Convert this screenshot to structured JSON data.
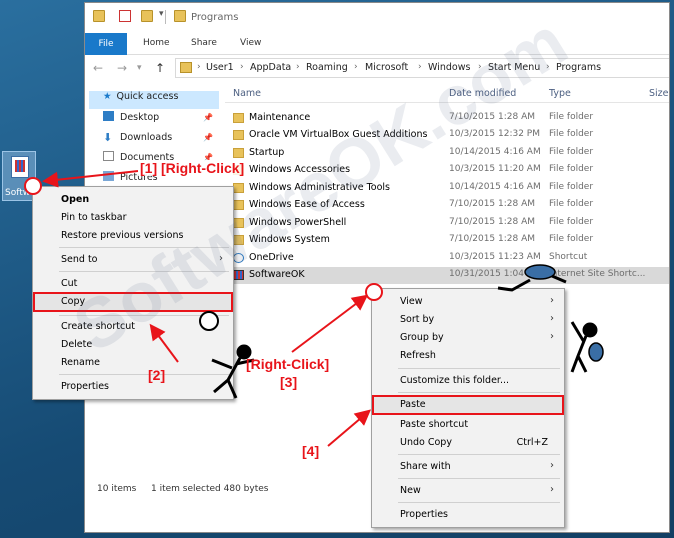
{
  "window": {
    "title": "Programs",
    "ribbon_tabs": [
      "File",
      "Home",
      "Share",
      "View"
    ],
    "breadcrumb": [
      "User1",
      "AppData",
      "Roaming",
      "Microsoft",
      "Windows",
      "Start Menu",
      "Programs"
    ]
  },
  "nav": {
    "items": [
      "Quick access",
      "Desktop",
      "Downloads",
      "Documents",
      "Pictures"
    ]
  },
  "columns": {
    "name": "Name",
    "date": "Date modified",
    "type": "Type",
    "size": "Size"
  },
  "files": [
    {
      "name": "Maintenance",
      "date": "7/10/2015 1:28 AM",
      "type": "File folder"
    },
    {
      "name": "Oracle VM VirtualBox Guest Additions",
      "date": "10/3/2015 12:32 PM",
      "type": "File folder"
    },
    {
      "name": "Startup",
      "date": "10/14/2015 4:16 AM",
      "type": "File folder"
    },
    {
      "name": "Windows Accessories",
      "date": "10/3/2015 11:20 AM",
      "type": "File folder"
    },
    {
      "name": "Windows Administrative Tools",
      "date": "10/14/2015 4:16 AM",
      "type": "File folder"
    },
    {
      "name": "Windows Ease of Access",
      "date": "7/10/2015 1:28 AM",
      "type": "File folder"
    },
    {
      "name": "Windows PowerShell",
      "date": "7/10/2015 1:28 AM",
      "type": "File folder"
    },
    {
      "name": "Windows System",
      "date": "7/10/2015 1:28 AM",
      "type": "File folder"
    },
    {
      "name": "OneDrive",
      "date": "10/3/2015 11:23 AM",
      "type": "Shortcut"
    },
    {
      "name": "SoftwareOK",
      "date": "10/31/2015 1:04 PM",
      "type": "Internet Site Shortc..."
    }
  ],
  "status": {
    "count": "10 items",
    "selected": "1 item selected  480 bytes"
  },
  "desktop_icon": {
    "label": "SoftwareOK"
  },
  "menu1": {
    "open": "Open",
    "pin": "Pin to taskbar",
    "restore": "Restore previous versions",
    "sendto": "Send to",
    "cut": "Cut",
    "copy": "Copy",
    "create_shortcut": "Create shortcut",
    "delete": "Delete",
    "rename": "Rename",
    "properties": "Properties"
  },
  "menu2": {
    "view": "View",
    "sortby": "Sort by",
    "groupby": "Group by",
    "refresh": "Refresh",
    "customize": "Customize this folder...",
    "paste": "Paste",
    "paste_shortcut": "Paste shortcut",
    "undo": "Undo Copy",
    "undo_shortcut": "Ctrl+Z",
    "sharewith": "Share with",
    "new": "New",
    "properties": "Properties"
  },
  "annotations": {
    "step1": "[1] [Right-Click]",
    "step2": "[2]",
    "step3a": "[Right-Click]",
    "step3b": "[3]",
    "step4": "[4]"
  },
  "watermark": "SoftwareOK.com",
  "colors": {
    "accent": "#1979ca",
    "annotation": "#e8141a",
    "selection": "#cce8ff"
  }
}
